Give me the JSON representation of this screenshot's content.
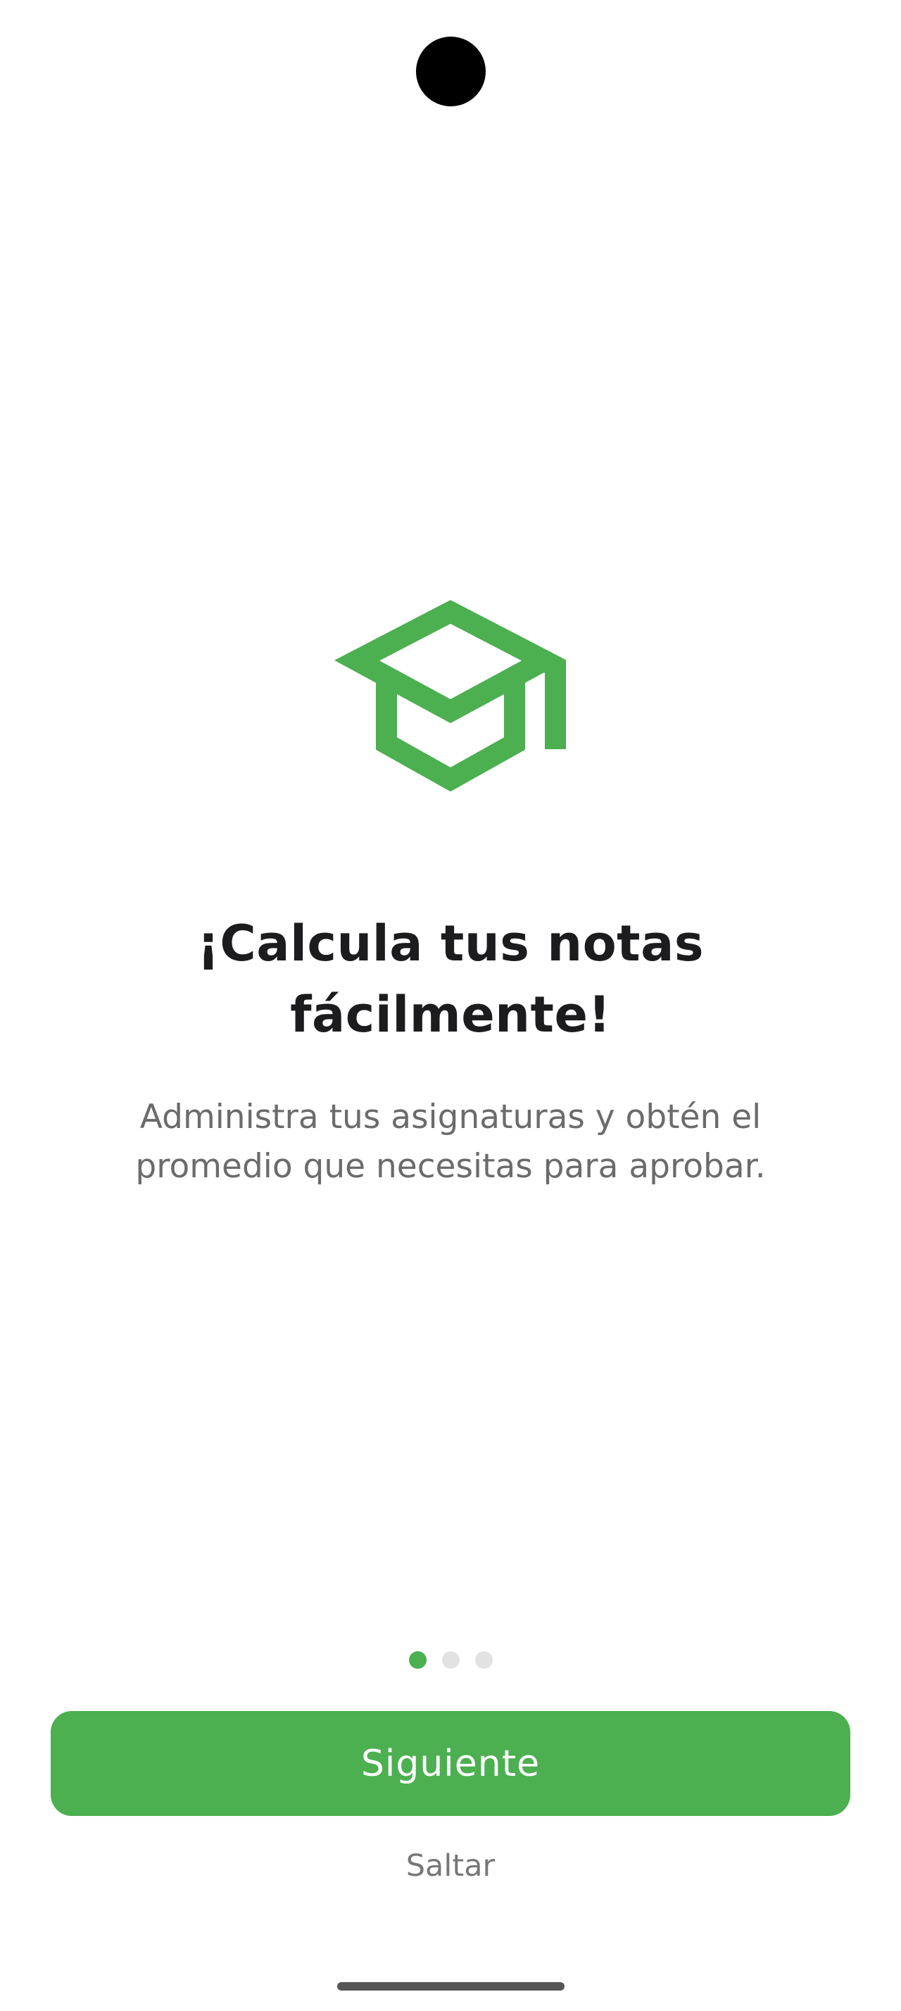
{
  "colors": {
    "accent": "#4caf50",
    "dot_inactive": "#e2e2e2",
    "title": "#1c1c1e",
    "subtitle": "#6b6b6b",
    "skip": "#777777"
  },
  "onboarding": {
    "icon": "graduation-cap-icon",
    "title_line1": "¡Calcula tus notas",
    "title_line2": "fácilmente!",
    "subtitle_line1": "Administra tus asignaturas y obtén el",
    "subtitle_line2": "promedio que necesitas para aprobar.",
    "current_page": 1,
    "page_count": 3
  },
  "actions": {
    "next_label": "Siguiente",
    "skip_label": "Saltar"
  }
}
